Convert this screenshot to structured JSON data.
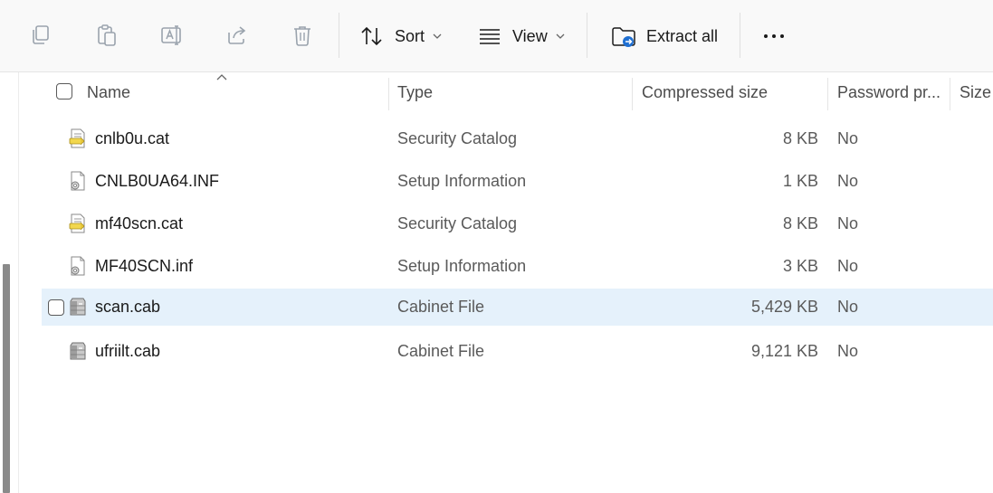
{
  "toolbar": {
    "icons": [
      "copy-icon",
      "paste-icon",
      "rename-icon",
      "share-icon",
      "delete-icon"
    ],
    "sort_label": "Sort",
    "view_label": "View",
    "extract_label": "Extract all",
    "more_icon": "more-options-icon"
  },
  "columns": {
    "name": "Name",
    "type": "Type",
    "compressed_size": "Compressed size",
    "password": "Password pr...",
    "size": "Size"
  },
  "files": [
    {
      "name": "cnlb0u.cat",
      "type": "Security Catalog",
      "compressed_size": "8 KB",
      "password": "No",
      "icon": "catalog-file-icon",
      "selected": false
    },
    {
      "name": "CNLB0UA64.INF",
      "type": "Setup Information",
      "compressed_size": "1 KB",
      "password": "No",
      "icon": "setup-file-icon",
      "selected": false
    },
    {
      "name": "mf40scn.cat",
      "type": "Security Catalog",
      "compressed_size": "8 KB",
      "password": "No",
      "icon": "catalog-file-icon",
      "selected": false
    },
    {
      "name": "MF40SCN.inf",
      "type": "Setup Information",
      "compressed_size": "3 KB",
      "password": "No",
      "icon": "setup-file-icon",
      "selected": false
    },
    {
      "name": "scan.cab",
      "type": "Cabinet File",
      "compressed_size": "5,429 KB",
      "password": "No",
      "icon": "cabinet-file-icon",
      "selected": true
    },
    {
      "name": "ufriilt.cab",
      "type": "Cabinet File",
      "compressed_size": "9,121 KB",
      "password": "No",
      "icon": "cabinet-file-icon",
      "selected": false
    }
  ],
  "colors": {
    "selection_background": "#e5f1fb",
    "disabled_icon": "#9aa3ad",
    "accent_blue": "#1f6fd1"
  }
}
